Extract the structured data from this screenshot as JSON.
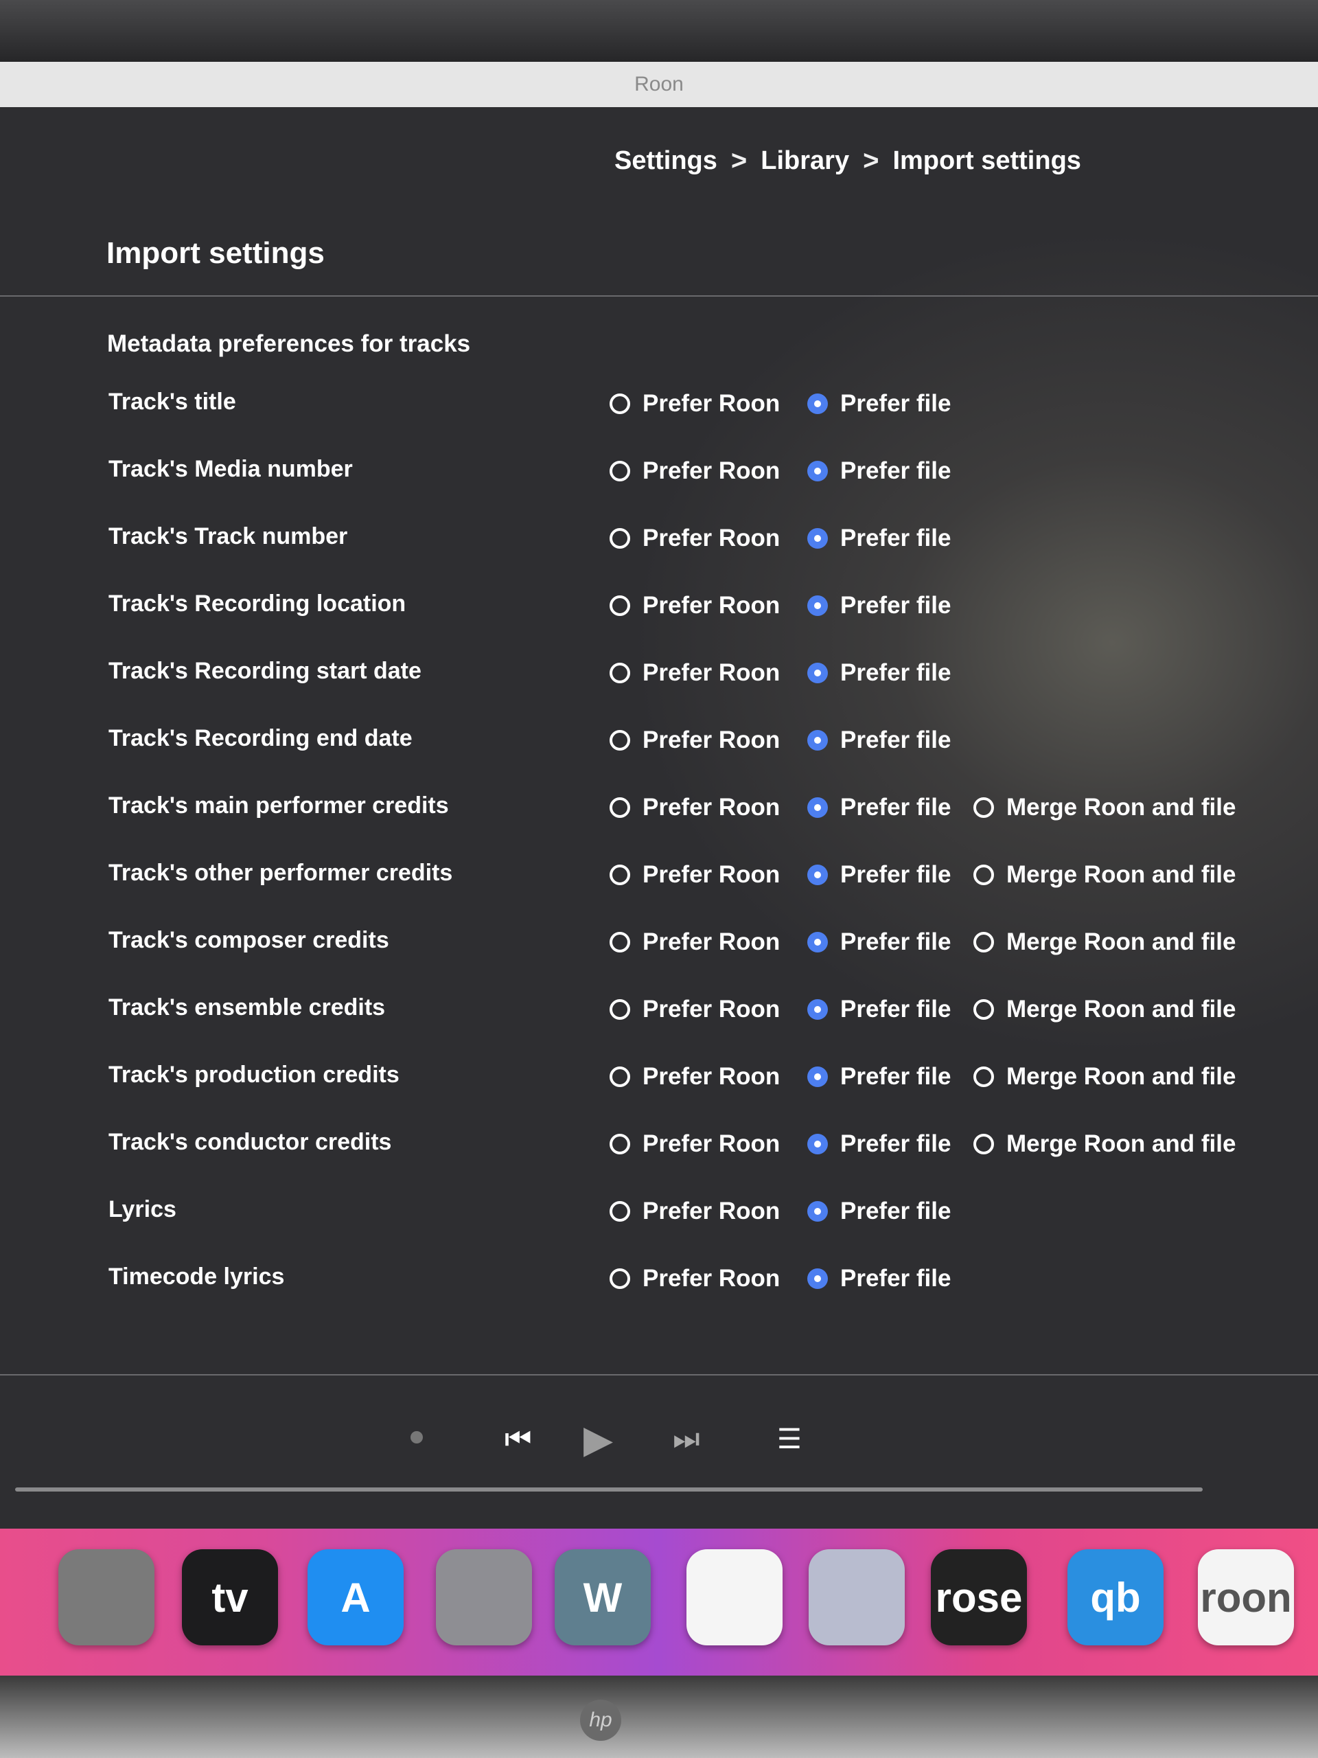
{
  "window": {
    "title": "Roon"
  },
  "breadcrumb": [
    "Settings",
    "Library",
    "Import settings"
  ],
  "breadcrumb_separator": ">",
  "page_title": "Import settings",
  "section_title": "Metadata preferences for tracks",
  "options": {
    "prefer_roon": "Prefer Roon",
    "prefer_file": "Prefer file",
    "merge": "Merge Roon and file"
  },
  "rows": [
    {
      "label": "Track's title",
      "selected": "prefer_file",
      "has_merge": false
    },
    {
      "label": "Track's Media number",
      "selected": "prefer_file",
      "has_merge": false
    },
    {
      "label": "Track's Track number",
      "selected": "prefer_file",
      "has_merge": false
    },
    {
      "label": "Track's Recording location",
      "selected": "prefer_file",
      "has_merge": false
    },
    {
      "label": "Track's Recording start date",
      "selected": "prefer_file",
      "has_merge": false
    },
    {
      "label": "Track's Recording end date",
      "selected": "prefer_file",
      "has_merge": false
    },
    {
      "label": "Track's main performer credits",
      "selected": "prefer_file",
      "has_merge": true
    },
    {
      "label": "Track's other performer credits",
      "selected": "prefer_file",
      "has_merge": true
    },
    {
      "label": "Track's composer credits",
      "selected": "prefer_file",
      "has_merge": true
    },
    {
      "label": "Track's ensemble credits",
      "selected": "prefer_file",
      "has_merge": true
    },
    {
      "label": "Track's production credits",
      "selected": "prefer_file",
      "has_merge": true
    },
    {
      "label": "Track's conductor credits",
      "selected": "prefer_file",
      "has_merge": true
    },
    {
      "label": "Lyrics",
      "selected": "prefer_file",
      "has_merge": false
    },
    {
      "label": "Timecode lyrics",
      "selected": "prefer_file",
      "has_merge": false
    }
  ],
  "transport": {
    "icons": [
      "status-dot-icon",
      "skip-previous-icon",
      "play-icon",
      "skip-next-icon",
      "queue-icon"
    ]
  },
  "dock": {
    "apps": [
      {
        "name": "calculator",
        "label": "",
        "icon": "calculator-icon",
        "color": "#7a7a7a"
      },
      {
        "name": "apple-tv",
        "label": "tv",
        "icon": "apple-tv-icon",
        "color": "#1c1c1e"
      },
      {
        "name": "app-store",
        "label": "A",
        "icon": "app-store-icon",
        "color": "#1f8ef1"
      },
      {
        "name": "system-settings",
        "label": "",
        "icon": "gear-icon",
        "color": "#8e8e93"
      },
      {
        "name": "w-app",
        "label": "W",
        "icon": "w-app-icon",
        "color": "#5f7f8f"
      },
      {
        "name": "microphone-app",
        "label": "",
        "icon": "microphone-icon",
        "color": "#f5f5f5"
      },
      {
        "name": "sheet-music-app",
        "label": "",
        "icon": "sheet-music-icon",
        "color": "#b8bccf"
      },
      {
        "name": "rose",
        "label": "rose",
        "icon": "rose-icon",
        "color": "#222222"
      },
      {
        "name": "qobuz",
        "label": "qb",
        "icon": "qobuz-icon",
        "color": "#2a8fe0"
      },
      {
        "name": "roon",
        "label": "roon",
        "icon": "roon-icon",
        "color": "#f4f4f4"
      }
    ]
  },
  "monitor": {
    "brand": "hp"
  }
}
